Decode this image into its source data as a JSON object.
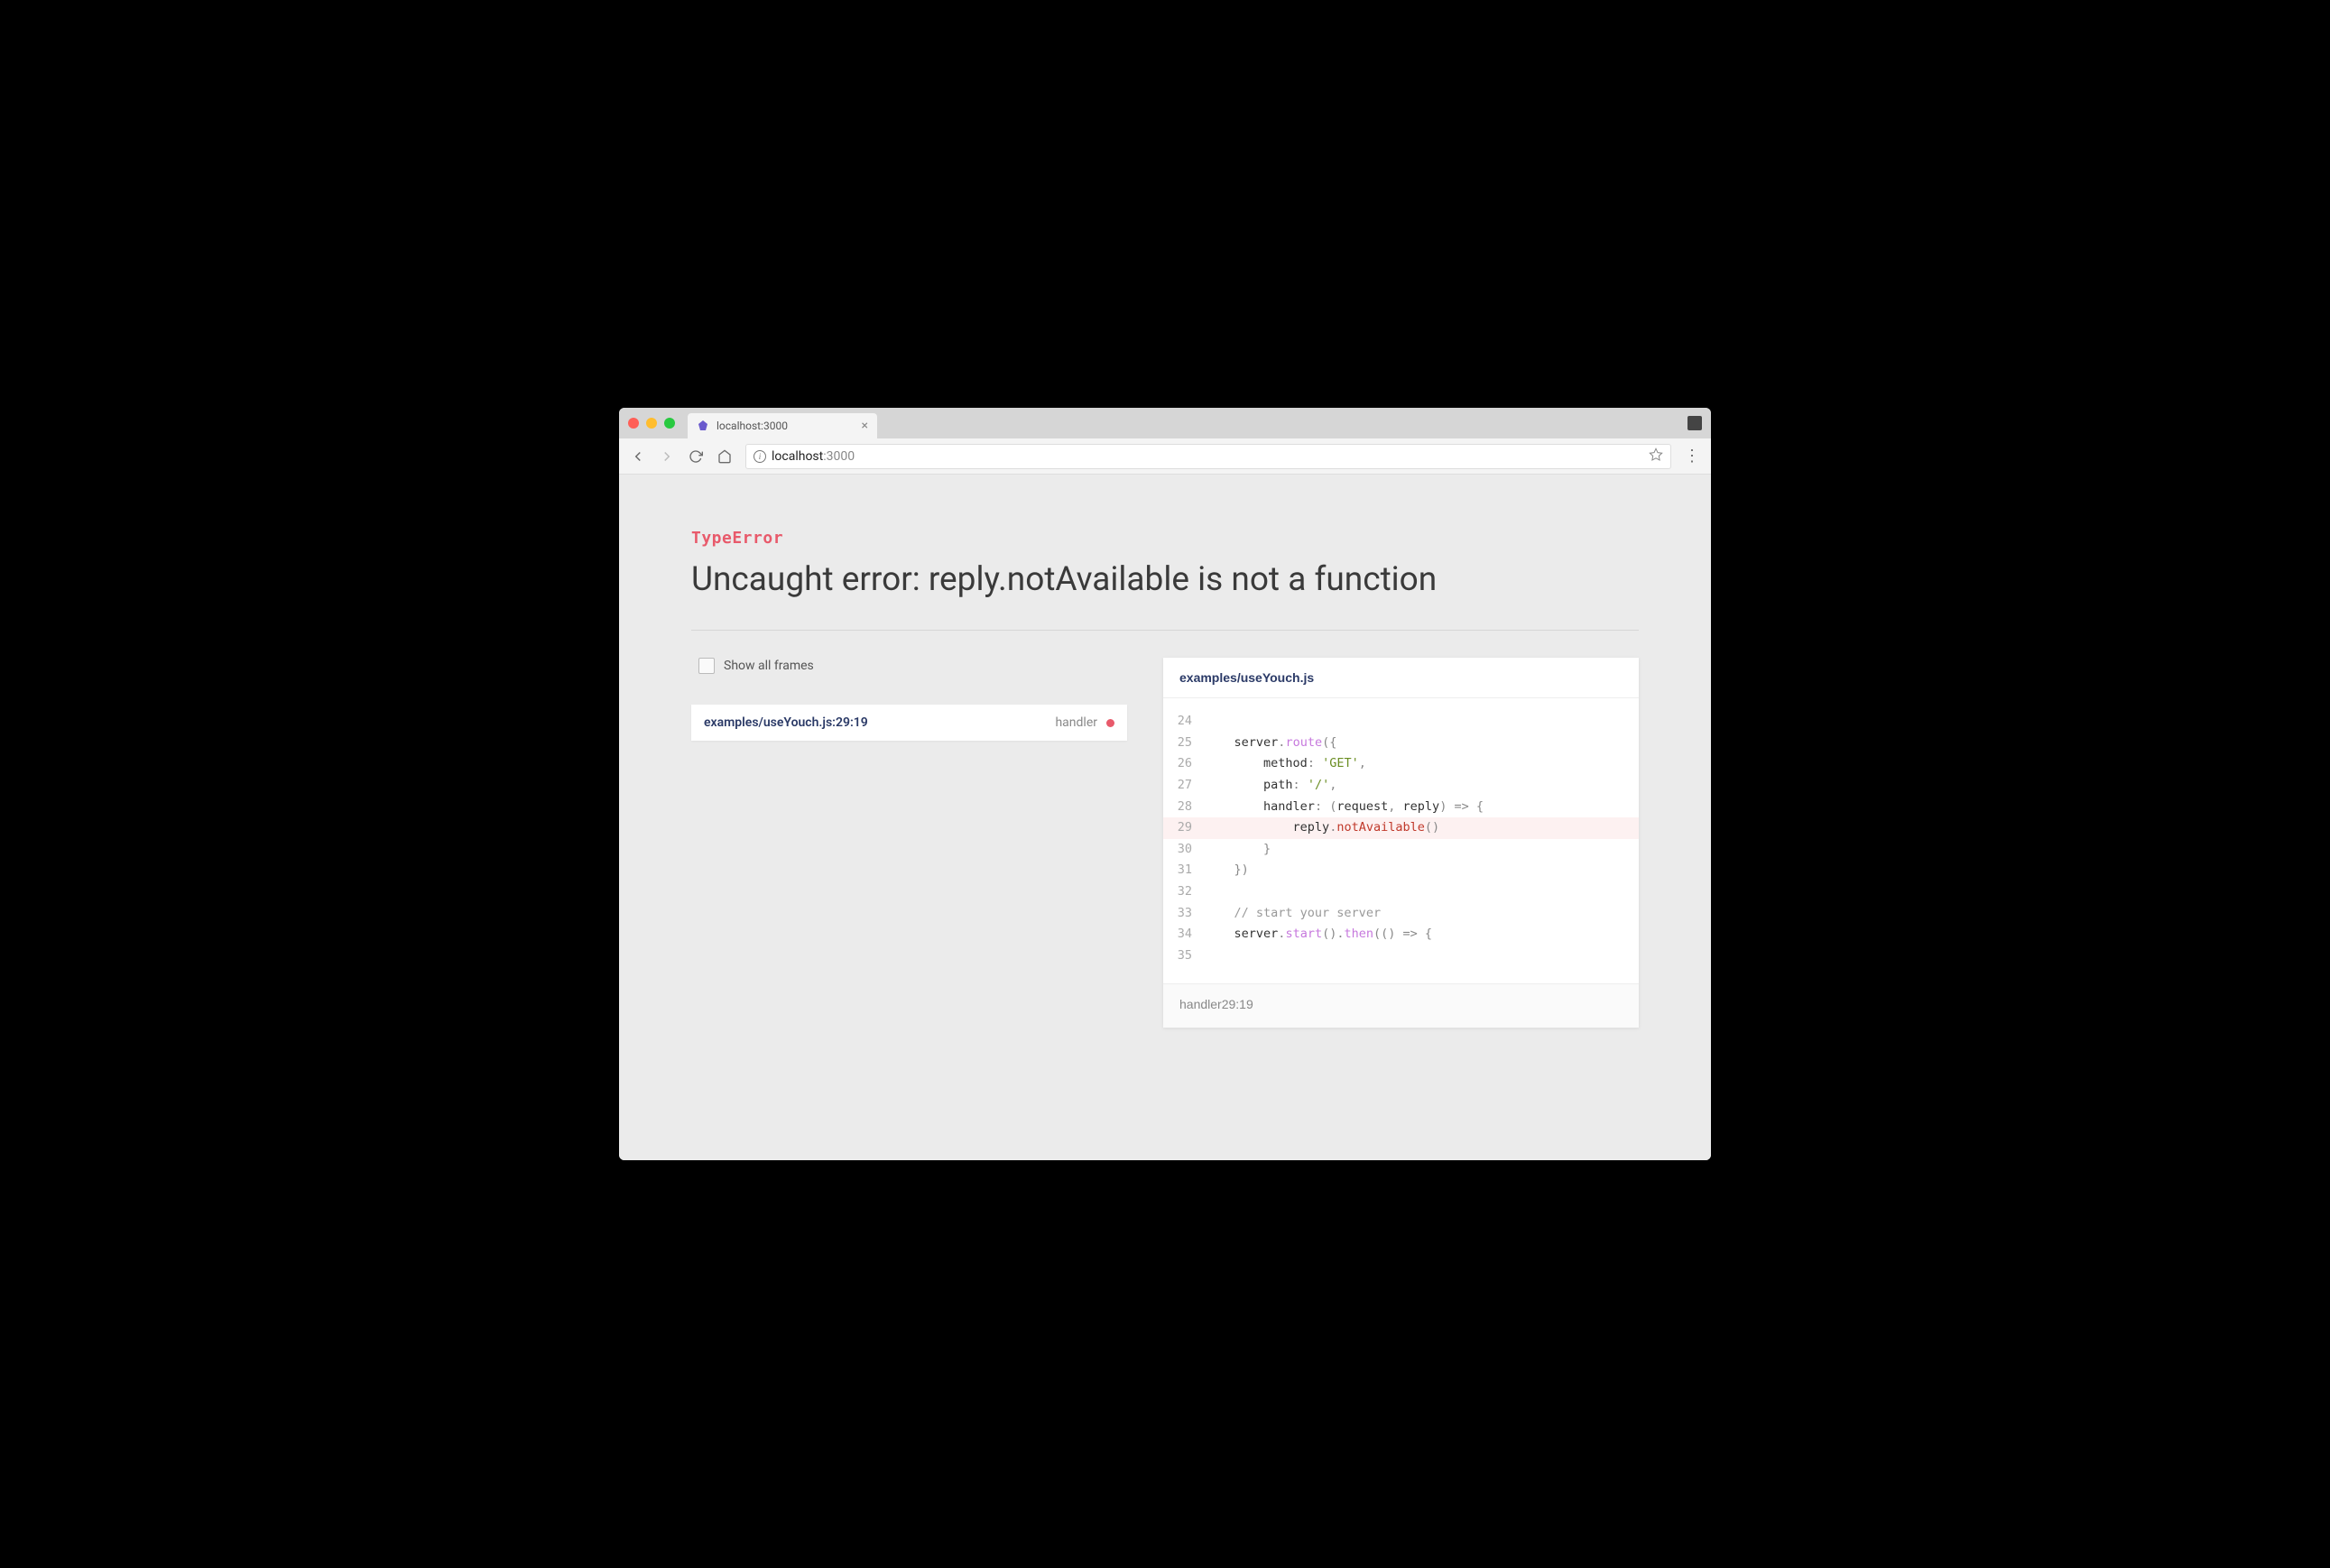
{
  "browser": {
    "tab_title": "localhost:3000",
    "url_host": "localhost",
    "url_port": ":3000"
  },
  "error": {
    "type": "TypeError",
    "title": "Uncaught error: reply.notAvailable is not a function"
  },
  "frames": {
    "show_all_label": "Show all frames",
    "items": [
      {
        "file": "examples/useYouch.js:29:19",
        "func": "handler"
      }
    ]
  },
  "code": {
    "file": "examples/useYouch.js",
    "footer": "handler29:19",
    "highlighted_line": 29,
    "lines": [
      {
        "n": 24,
        "html": ""
      },
      {
        "n": 25,
        "html": "    <span class='tok-id'>server</span><span class='tok-punc'>.</span><span class='tok-prop'>route</span><span class='tok-punc'>({</span>"
      },
      {
        "n": 26,
        "html": "        <span class='tok-id'>method</span><span class='tok-punc'>:</span> <span class='tok-str'>'GET'</span><span class='tok-punc'>,</span>"
      },
      {
        "n": 27,
        "html": "        <span class='tok-id'>path</span><span class='tok-punc'>:</span> <span class='tok-str'>'/'</span><span class='tok-punc'>,</span>"
      },
      {
        "n": 28,
        "html": "        <span class='tok-id'>handler</span><span class='tok-punc'>:</span> <span class='tok-punc'>(</span><span class='tok-id'>request</span><span class='tok-punc'>,</span> <span class='tok-id'>reply</span><span class='tok-punc'>)</span> <span class='tok-punc'>=&gt;</span> <span class='tok-punc'>{</span>"
      },
      {
        "n": 29,
        "html": "            <span class='tok-id'>reply</span><span class='tok-punc'>.</span><span class='tok-err'>notAvailable</span><span class='tok-punc'>()</span>"
      },
      {
        "n": 30,
        "html": "        <span class='tok-punc'>}</span>"
      },
      {
        "n": 31,
        "html": "    <span class='tok-punc'>})</span>"
      },
      {
        "n": 32,
        "html": ""
      },
      {
        "n": 33,
        "html": "    <span class='tok-comment'>// start your server</span>"
      },
      {
        "n": 34,
        "html": "    <span class='tok-id'>server</span><span class='tok-punc'>.</span><span class='tok-prop'>start</span><span class='tok-punc'>().</span><span class='tok-prop'>then</span><span class='tok-punc'>(()</span> <span class='tok-punc'>=&gt;</span> <span class='tok-punc'>{</span>"
      },
      {
        "n": 35,
        "html": ""
      }
    ]
  }
}
